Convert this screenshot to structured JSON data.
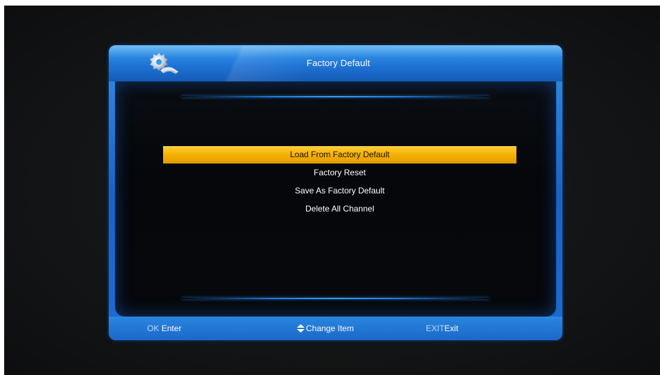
{
  "window": {
    "title": "Factory Default"
  },
  "menu": {
    "items": [
      {
        "label": "Load From Factory Default",
        "selected": true
      },
      {
        "label": "Factory Reset",
        "selected": false
      },
      {
        "label": "Save As Factory Default",
        "selected": false
      },
      {
        "label": "Delete All Channel",
        "selected": false
      }
    ]
  },
  "footer": {
    "ok_key": "OK",
    "ok_label": "Enter",
    "change_label": "Change Item",
    "exit_key": "EXIT",
    "exit_label": "Exit"
  },
  "colors": {
    "accent_blue": "#1f74d6",
    "selection_yellow": "#f5b000",
    "background": "#121314"
  },
  "icons": {
    "logo": "gear-settings-icon",
    "change": "up-down-arrows-icon"
  }
}
